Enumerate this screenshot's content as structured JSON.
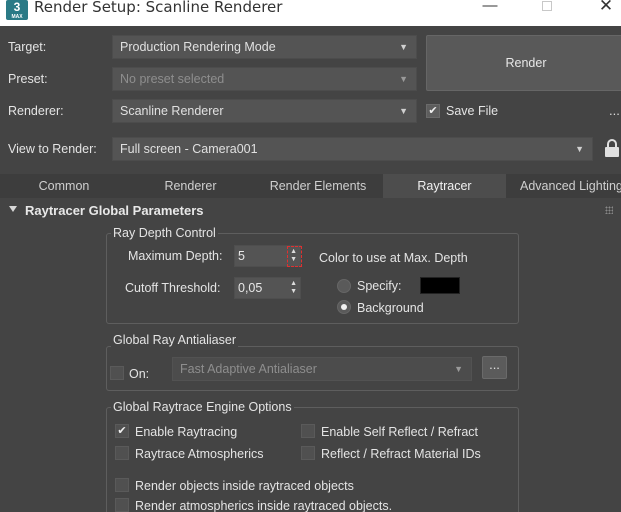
{
  "window": {
    "title": "Render Setup: Scanline Renderer",
    "app_icon_text": "3",
    "app_icon_subtext": "MAX",
    "minimize_glyph": "—",
    "close_glyph": "✕"
  },
  "form": {
    "target_label": "Target:",
    "target_value": "Production Rendering Mode",
    "preset_label": "Preset:",
    "preset_value": "No preset selected",
    "renderer_label": "Renderer:",
    "renderer_value": "Scanline Renderer",
    "save_file_label": "Save File",
    "save_file_checked": true,
    "view_label": "View to Render:",
    "view_value": "Full screen - Camera001",
    "render_button": "Render",
    "more_glyph": "...",
    "dropdown_arrow": "▼"
  },
  "tabs": [
    {
      "label": "Common",
      "active": false
    },
    {
      "label": "Renderer",
      "active": false
    },
    {
      "label": "Render Elements",
      "active": false
    },
    {
      "label": "Raytracer",
      "active": true
    },
    {
      "label": "Advanced Lighting",
      "active": false
    }
  ],
  "rollout": {
    "title": "Raytracer Global Parameters"
  },
  "ray_depth": {
    "group_title": "Ray Depth Control",
    "max_depth_label": "Maximum Depth:",
    "max_depth_value": "5",
    "cutoff_label": "Cutoff Threshold:",
    "cutoff_value": "0,05",
    "color_label": "Color to use at Max. Depth",
    "specify_label": "Specify:",
    "background_label": "Background",
    "selected": "Background",
    "specify_color": "#000000",
    "spinner_glyph": "▲▼"
  },
  "antialiaser": {
    "group_title": "Global Ray Antialiaser",
    "on_label": "On:",
    "on_checked": false,
    "value": "Fast Adaptive Antialiaser",
    "button_label": "..."
  },
  "engine": {
    "group_title": "Global Raytrace Engine Options",
    "enable_raytracing": "Enable Raytracing",
    "enable_raytracing_checked": true,
    "raytrace_atmospherics": "Raytrace Atmospherics",
    "raytrace_atmospherics_checked": false,
    "enable_self_reflect": "Enable Self Reflect / Refract",
    "enable_self_reflect_checked": false,
    "reflect_refract_ids": "Reflect / Refract Material IDs",
    "reflect_refract_ids_checked": false,
    "render_inside": "Render objects inside raytraced objects",
    "render_inside_checked": false,
    "render_atmo_inside": "Render atmospherics inside raytraced objects.",
    "render_atmo_inside_checked": false
  },
  "colors": {
    "panel_bg": "#444444",
    "tab_active_bg": "#4d4d4d",
    "focus_outline": "#e03030"
  }
}
